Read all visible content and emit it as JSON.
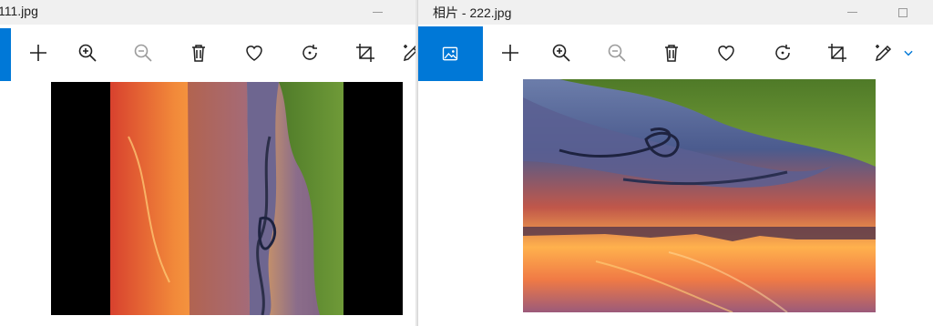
{
  "windows": [
    {
      "title": "111.jpg",
      "toolbar": [
        {
          "name": "add-icon",
          "label": "Add"
        },
        {
          "name": "zoom-in-icon",
          "label": "Zoom in"
        },
        {
          "name": "zoom-out-icon",
          "label": "Zoom out"
        },
        {
          "name": "delete-icon",
          "label": "Delete"
        },
        {
          "name": "favorite-icon",
          "label": "Favorite"
        },
        {
          "name": "rotate-icon",
          "label": "Rotate"
        },
        {
          "name": "crop-icon",
          "label": "Crop"
        },
        {
          "name": "edit-icon",
          "label": "Edit"
        }
      ],
      "image_orientation": "rotated 90deg (portrait, letterboxed)"
    },
    {
      "title": "相片 - 222.jpg",
      "toolbar": [
        {
          "name": "photo-icon",
          "label": "Photos"
        },
        {
          "name": "add-icon",
          "label": "Add"
        },
        {
          "name": "zoom-in-icon",
          "label": "Zoom in"
        },
        {
          "name": "zoom-out-icon",
          "label": "Zoom out"
        },
        {
          "name": "delete-icon",
          "label": "Delete"
        },
        {
          "name": "favorite-icon",
          "label": "Favorite"
        },
        {
          "name": "rotate-icon",
          "label": "Rotate"
        },
        {
          "name": "crop-icon",
          "label": "Crop"
        },
        {
          "name": "edit-icon",
          "label": "Edit"
        },
        {
          "name": "chevron-down-icon",
          "label": "More"
        }
      ],
      "image_orientation": "upside down (landscape)"
    }
  ],
  "colors": {
    "accent": "#0078d7",
    "titlebar": "#f0f0f0",
    "letterbox": "#000000",
    "icon": "#1f1f1f",
    "icon_disabled": "#9b9b9b"
  }
}
